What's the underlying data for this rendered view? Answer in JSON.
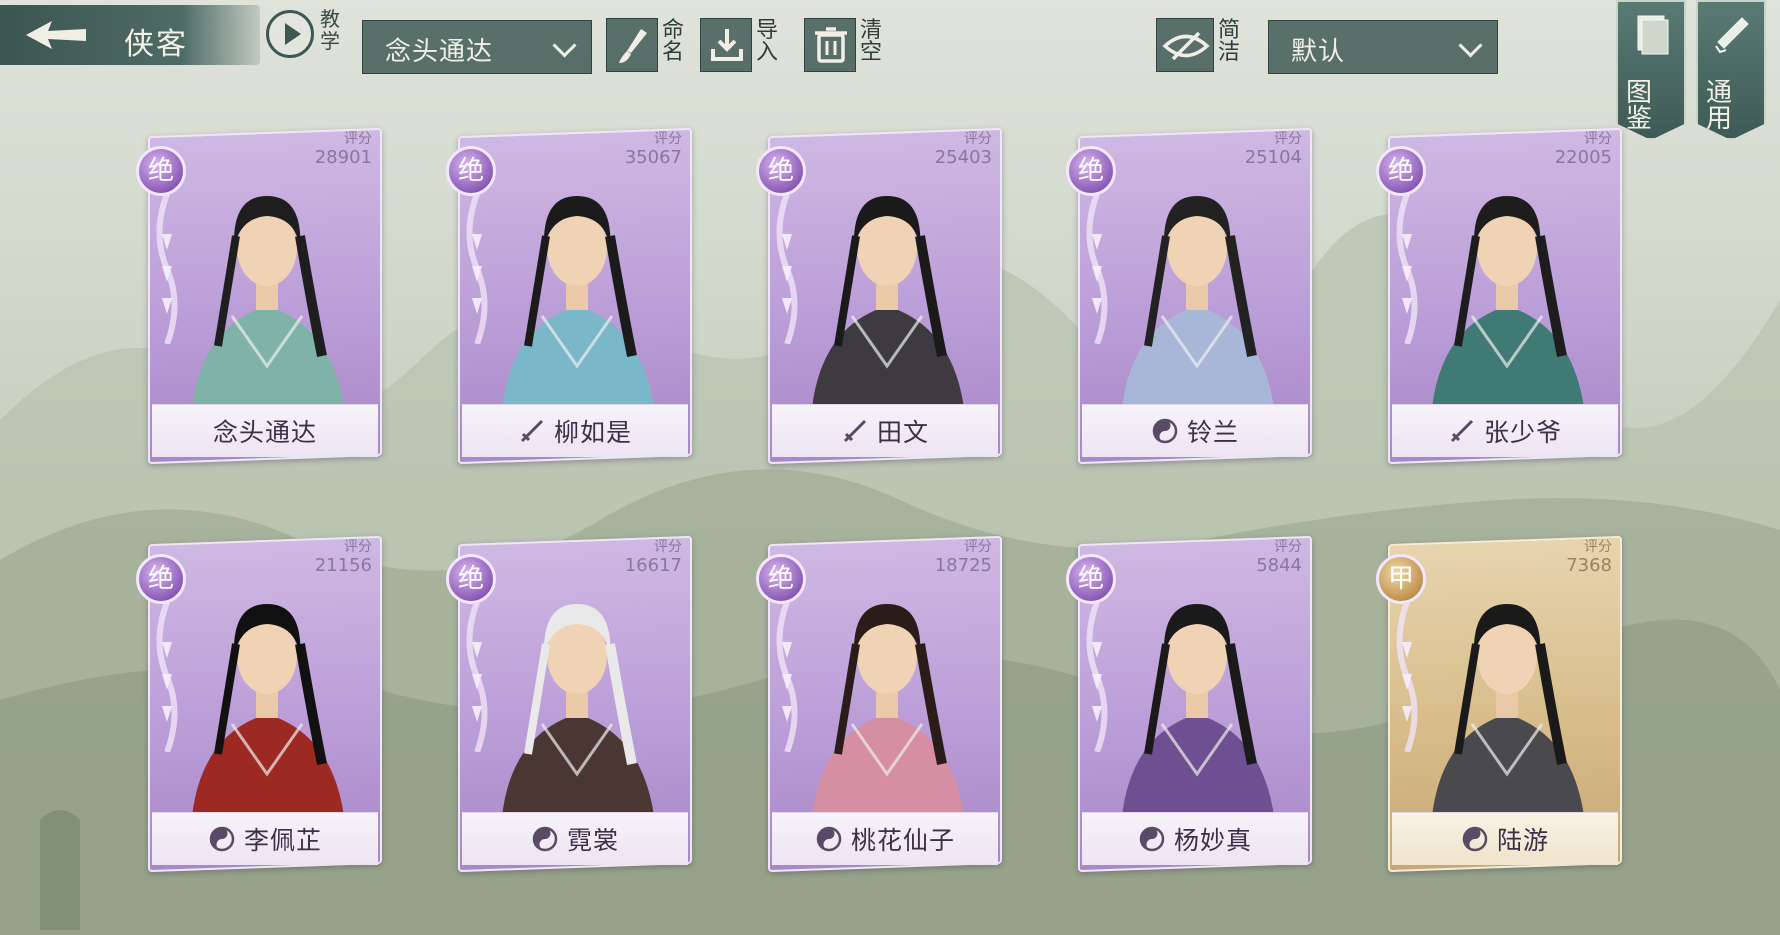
{
  "header": {
    "title": "侠客",
    "tutorial_label": "教学",
    "preset_select": "念头通达",
    "rename_label": "命名",
    "import_label": "导入",
    "clear_label": "清空",
    "simple_label": "简洁",
    "sort_select": "默认"
  },
  "side": {
    "codex_label": "图鉴",
    "general_label": "通用"
  },
  "score_label": "评分",
  "cards": [
    {
      "rank": "绝",
      "score": "28901",
      "name": "念头通达",
      "school": "none",
      "frame": "purple"
    },
    {
      "rank": "绝",
      "score": "35067",
      "name": "柳如是",
      "school": "sword-icon",
      "frame": "purple"
    },
    {
      "rank": "绝",
      "score": "25403",
      "name": "田文",
      "school": "sword-icon",
      "frame": "purple"
    },
    {
      "rank": "绝",
      "score": "25104",
      "name": "铃兰",
      "school": "taiji-icon",
      "frame": "purple"
    },
    {
      "rank": "绝",
      "score": "22005",
      "name": "张少爷",
      "school": "sword-icon",
      "frame": "purple"
    },
    {
      "rank": "绝",
      "score": "21156",
      "name": "李佩芷",
      "school": "taiji-icon",
      "frame": "purple"
    },
    {
      "rank": "绝",
      "score": "16617",
      "name": "霓裳",
      "school": "taiji-icon",
      "frame": "purple"
    },
    {
      "rank": "绝",
      "score": "18725",
      "name": "桃花仙子",
      "school": "taiji-icon",
      "frame": "purple"
    },
    {
      "rank": "绝",
      "score": "5844",
      "name": "杨妙真",
      "school": "taiji-icon",
      "frame": "purple"
    },
    {
      "rank": "甲",
      "score": "7368",
      "name": "陆游",
      "school": "taiji-icon",
      "frame": "gold"
    }
  ],
  "colors": {
    "purple_frame": "#b99bd6",
    "gold_frame": "#d6bb88",
    "toolbar": "#465f5a"
  }
}
